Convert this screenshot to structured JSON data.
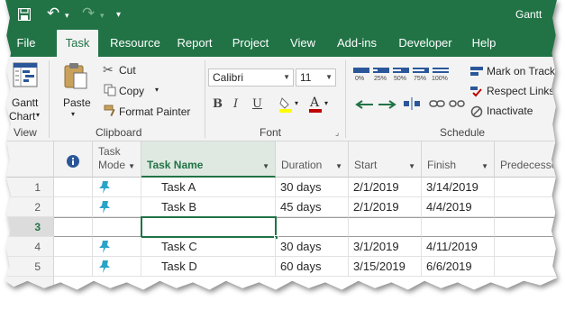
{
  "titlebar": {
    "save_icon": "save-icon",
    "undo_glyph": "↶",
    "redo_glyph": "↷",
    "customize_glyph": "▾",
    "app_title": "Gantt"
  },
  "tabs": [
    {
      "label": "File"
    },
    {
      "label": "Task"
    },
    {
      "label": "Resource"
    },
    {
      "label": "Report"
    },
    {
      "label": "Project"
    },
    {
      "label": "View"
    },
    {
      "label": "Add-ins"
    },
    {
      "label": "Developer"
    },
    {
      "label": "Help"
    }
  ],
  "ribbon": {
    "view_group": {
      "button_line1": "Gantt",
      "button_line2": "Chart",
      "label": "View"
    },
    "clipboard_group": {
      "paste": "Paste",
      "cut": "Cut",
      "copy": "Copy",
      "format_painter": "Format Painter",
      "label": "Clipboard"
    },
    "font_group": {
      "font_name": "Calibri",
      "font_size": "11",
      "bold": "B",
      "italic": "I",
      "underline": "U",
      "label": "Font"
    },
    "schedule_group": {
      "percent_labels": [
        "0%",
        "25%",
        "50%",
        "75%",
        "100%"
      ],
      "mark_on_track": "Mark on Track",
      "respect_links": "Respect Links",
      "inactivate": "Inactivate",
      "label": "Schedule"
    }
  },
  "colors": {
    "accent": "#217346",
    "pin": "#2aa3c8",
    "highlight": "#ffff00",
    "font_red": "#c00000"
  },
  "grid": {
    "columns": [
      "Task Mode",
      "Task Name",
      "Duration",
      "Start",
      "Finish",
      "Predecessors"
    ],
    "info_icon": "info-icon",
    "rows": [
      {
        "num": "1",
        "mode_icon": "pin-icon",
        "name": "Task A",
        "duration": "30 days",
        "start": "2/1/2019",
        "finish": "3/14/2019",
        "pred": ""
      },
      {
        "num": "2",
        "mode_icon": "pin-icon",
        "name": "Task B",
        "duration": "45 days",
        "start": "2/1/2019",
        "finish": "4/4/2019",
        "pred": ""
      },
      {
        "num": "3",
        "mode_icon": "",
        "name": "",
        "duration": "",
        "start": "",
        "finish": "",
        "pred": ""
      },
      {
        "num": "4",
        "mode_icon": "pin-icon",
        "name": "Task C",
        "duration": "30 days",
        "start": "3/1/2019",
        "finish": "4/11/2019",
        "pred": ""
      },
      {
        "num": "5",
        "mode_icon": "pin-icon",
        "name": "Task D",
        "duration": "60 days",
        "start": "3/15/2019",
        "finish": "6/6/2019",
        "pred": ""
      }
    ]
  }
}
